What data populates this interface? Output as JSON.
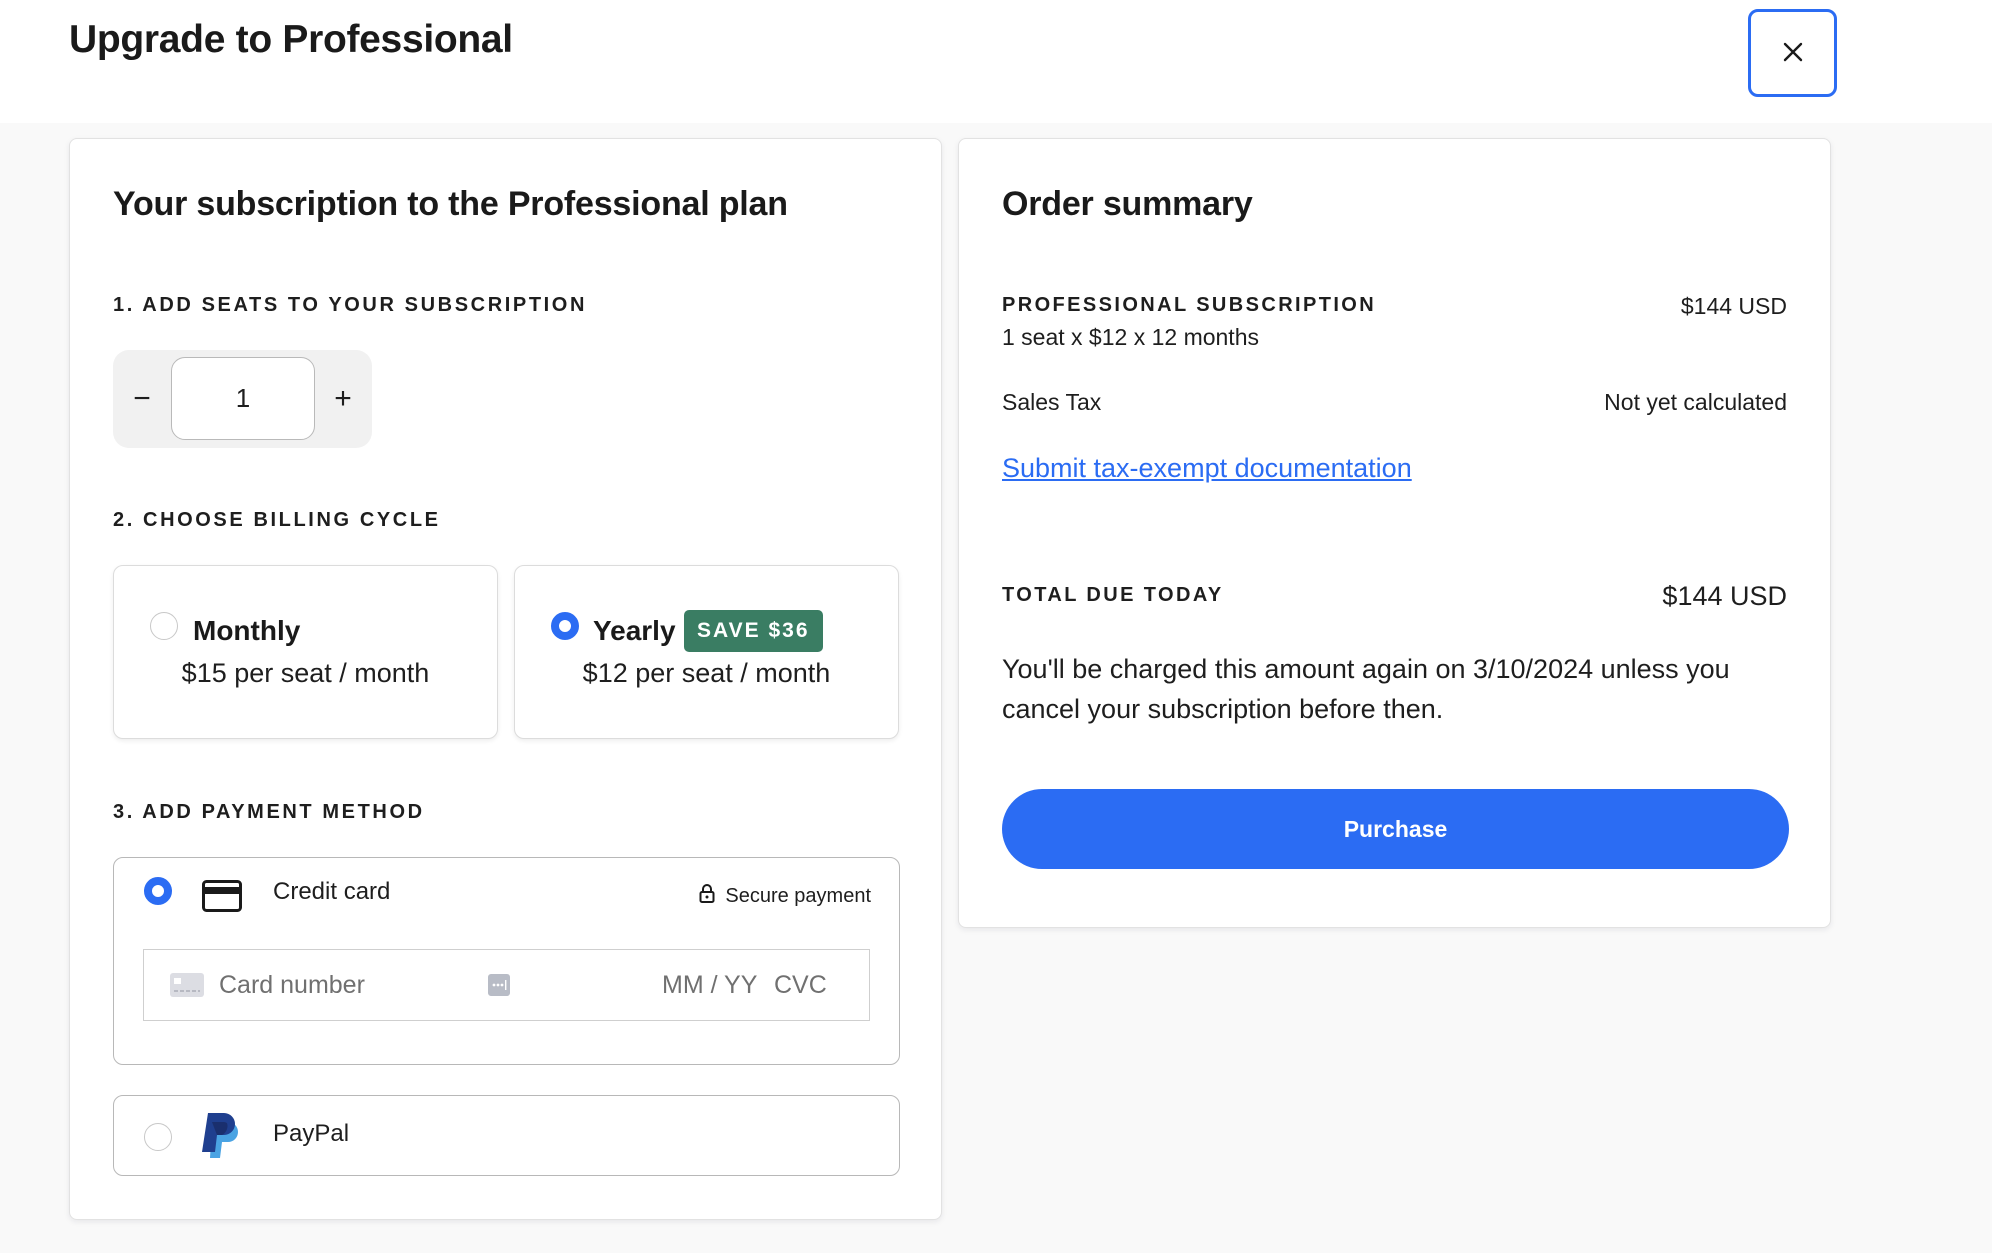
{
  "header": {
    "title": "Upgrade to Professional",
    "close_icon": "close-icon"
  },
  "subscription": {
    "title": "Your subscription to the Professional plan",
    "seats": {
      "label": "1. ADD SEATS TO YOUR SUBSCRIPTION",
      "value": "1",
      "decrement_label": "−",
      "increment_label": "+"
    },
    "billing": {
      "label": "2. CHOOSE BILLING CYCLE",
      "options": [
        {
          "name": "Monthly",
          "price": "$15 per seat / month",
          "selected": false
        },
        {
          "name": "Yearly",
          "price": "$12 per seat / month",
          "selected": true,
          "badge": "SAVE $36"
        }
      ]
    },
    "payment": {
      "label": "3. ADD PAYMENT METHOD",
      "methods": [
        {
          "name": "Credit card",
          "icon": "credit-card-icon",
          "selected": true
        },
        {
          "name": "PayPal",
          "icon": "paypal-logo-icon",
          "selected": false
        }
      ],
      "secure_label": "Secure payment",
      "card_number_placeholder": "Card number",
      "expiry_placeholder": "MM / YY",
      "cvc_placeholder": "CVC"
    }
  },
  "order_summary": {
    "title": "Order summary",
    "line_item": {
      "label": "PROFESSIONAL SUBSCRIPTION",
      "detail": "1 seat x $12 x 12 months",
      "amount": "$144 USD"
    },
    "sales_tax": {
      "label": "Sales Tax",
      "value": "Not yet calculated"
    },
    "tax_exempt_link": "Submit tax-exempt documentation",
    "total": {
      "label": "TOTAL DUE TODAY",
      "amount": "$144 USD"
    },
    "renewal_note": "You'll be charged this amount again on 3/10/2024 unless you cancel your subscription before then.",
    "purchase_label": "Purchase"
  },
  "colors": {
    "accent": "#2b6cf3",
    "badge_green": "#3a7d63",
    "paypal_dark": "#1f3f8f",
    "paypal_light": "#4aa3e3"
  }
}
